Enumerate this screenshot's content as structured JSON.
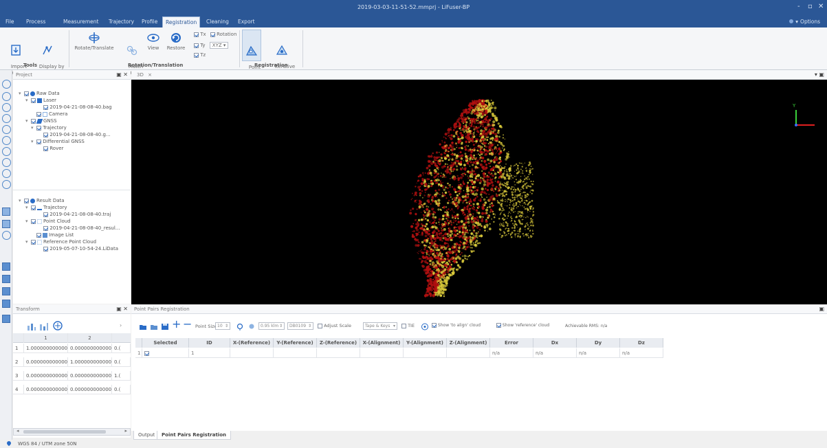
{
  "window": {
    "title": "2019-03-03-11-51-52.mmprj - LiFuser-BP",
    "controls": [
      "-",
      "▫",
      "✕"
    ]
  },
  "menu": {
    "items": [
      "File",
      "Process",
      "Measurement",
      "Trajectory",
      "Profile",
      "Registration",
      "Cleaning",
      "Export"
    ],
    "active": "Registration",
    "options_label": "Options"
  },
  "ribbon": {
    "tools": {
      "label": "Tools",
      "import_reference": "Import\nReference",
      "display_by_role": "Display by\nRole"
    },
    "rotation": {
      "label": "Rotation/Translation",
      "rotate_translate": "Rotate/Translate",
      "match_center": "Match\nCenter",
      "view": "View",
      "restore": "Restore",
      "tx": "Tx",
      "ty": "Ty",
      "tz": "Tz",
      "rotation_label": "Rotation",
      "axis_value": "XYZ"
    },
    "registration": {
      "label": "Registration",
      "point_pairs": "Point\nPairs",
      "icp": "Iterative\nClosest Point"
    }
  },
  "project_panel": {
    "title": "Project",
    "raw": {
      "root": "Raw Data",
      "laser": "Laser",
      "bag": "2019-04-21-08-08-40.bag",
      "camera": "Camera",
      "gnss": "GNSS",
      "trajectory": "Trajectory",
      "traj_file": "2019-04-21-08-08-40.g...",
      "diff_gnss": "Differential GNSS",
      "rover": "Rover"
    },
    "result": {
      "root": "Result Data",
      "trajectory": "Trajectory",
      "traj_file": "2019-04-21-08-08-40.traj",
      "point_cloud": "Point Cloud",
      "pc_file": "2019-04-21-08-08-40_resul...",
      "image_list": "Image List",
      "ref_cloud": "Reference Point Cloud",
      "ref_file": "2019-05-07-10-54-24.LiData"
    }
  },
  "viewport": {
    "tab": "3D",
    "close": "×",
    "axis_y": "Y"
  },
  "transform_panel": {
    "title": "Transform",
    "col_headers": [
      "1",
      "2"
    ],
    "rows": [
      [
        "1",
        "1.000000000000",
        "0.000000000000",
        "0.("
      ],
      [
        "2",
        "0.000000000000",
        "1.000000000000",
        "0.("
      ],
      [
        "3",
        "0.000000000000",
        "0.000000000000",
        "1.("
      ],
      [
        "4",
        "0.000000000000",
        "0.000000000000",
        "0.("
      ]
    ]
  },
  "point_pairs": {
    "title": "Point Pairs Registration",
    "point_size_label": "Point Size:",
    "point_size_value": "10",
    "field_a": "0.95 klm",
    "field_b": "DB0109",
    "adjust_scale": "Adjust Scale",
    "keys_mode": "Tape & Keys",
    "tie_label": "TIE",
    "show_align": "Show 'to align' cloud",
    "show_ref": "Show 'reference' cloud",
    "rms": "Achievable RMS: n/a",
    "columns": [
      "Selected",
      "ID",
      "X-(Reference)",
      "Y-(Reference)",
      "Z-(Reference)",
      "X-(Alignment)",
      "Y-(Alignment)",
      "Z-(Alignment)",
      "Error",
      "Dx",
      "Dy",
      "Dz"
    ],
    "rows": [
      {
        "index": "1",
        "id": "1",
        "error": "n/a",
        "dx": "n/a",
        "dy": "n/a",
        "dz": "n/a"
      }
    ]
  },
  "bottom_tabs": [
    "Output",
    "Point Pairs Registration"
  ],
  "status": {
    "crs": "WGS 84 / UTM zone 50N"
  },
  "colors": {
    "titlebar": "#2b5796",
    "accent": "#2a6cc7",
    "cloud_red": "#b01010",
    "cloud_yellow": "#d8c83a"
  }
}
